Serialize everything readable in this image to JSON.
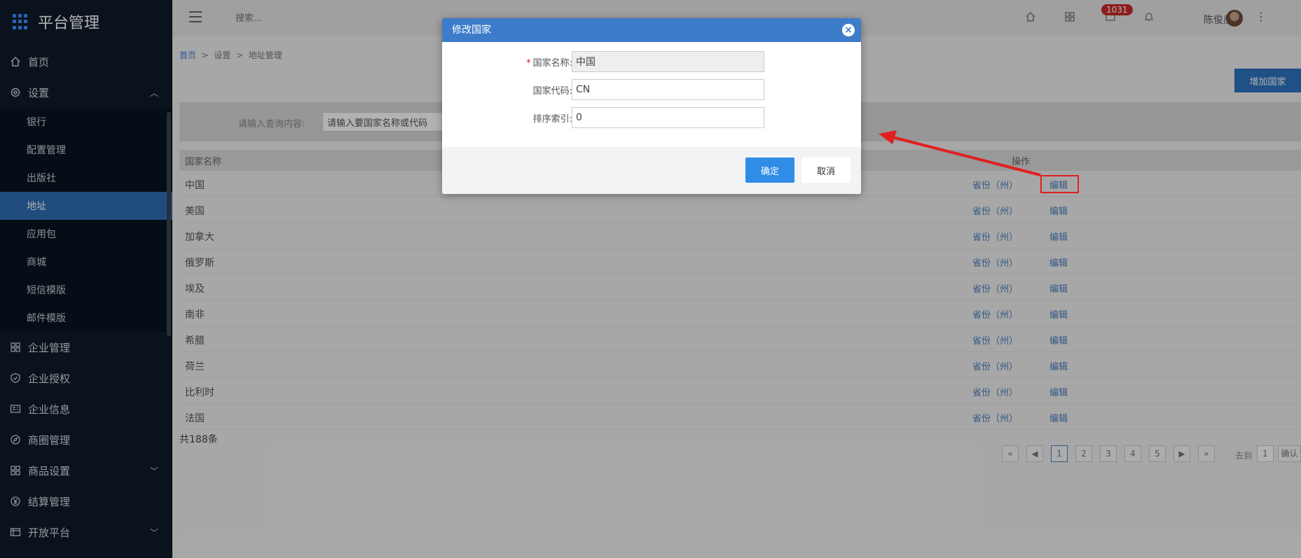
{
  "app": {
    "title": "平台管理"
  },
  "sidebar": {
    "items": [
      {
        "label": "首页"
      },
      {
        "label": "设置"
      },
      {
        "label": "企业管理"
      },
      {
        "label": "企业授权"
      },
      {
        "label": "企业信息"
      },
      {
        "label": "商圈管理"
      },
      {
        "label": "商品设置"
      },
      {
        "label": "结算管理"
      },
      {
        "label": "开放平台"
      }
    ],
    "settings_sub": [
      {
        "label": "银行"
      },
      {
        "label": "配置管理"
      },
      {
        "label": "出版社"
      },
      {
        "label": "地址"
      },
      {
        "label": "应用包"
      },
      {
        "label": "商城"
      },
      {
        "label": "短信模版"
      },
      {
        "label": "邮件模版"
      }
    ]
  },
  "topbar": {
    "search_placeholder": "搜索...",
    "badge_count": "1031",
    "user_name": "陈俊彦 ⌄"
  },
  "breadcrumb": {
    "home": "首页",
    "sep": ">",
    "level1": "设置",
    "level2": "地址管理"
  },
  "main": {
    "add_button": "增加国家",
    "filter_label": "请输入查询内容:",
    "filter_value": "请输入要国家名称或代码",
    "table": {
      "col_name": "国家名称",
      "col_ops": "操作",
      "rows": [
        {
          "name": "中国",
          "op1": "省份（州）",
          "op2": "编辑"
        },
        {
          "name": "美国",
          "op1": "省份（州）",
          "op2": "编辑"
        },
        {
          "name": "加拿大",
          "op1": "省份（州）",
          "op2": "编辑"
        },
        {
          "name": "俄罗斯",
          "op1": "省份（州）",
          "op2": "编辑"
        },
        {
          "name": "埃及",
          "op1": "省份（州）",
          "op2": "编辑"
        },
        {
          "name": "南非",
          "op1": "省份（州）",
          "op2": "编辑"
        },
        {
          "name": "希腊",
          "op1": "省份（州）",
          "op2": "编辑"
        },
        {
          "name": "荷兰",
          "op1": "省份（州）",
          "op2": "编辑"
        },
        {
          "name": "比利时",
          "op1": "省份（州）",
          "op2": "编辑"
        },
        {
          "name": "法国",
          "op1": "省份（州）",
          "op2": "编辑"
        }
      ]
    },
    "total": "共188条",
    "pager": {
      "first": "«",
      "prev": "◀",
      "pages": [
        "1",
        "2",
        "3",
        "4",
        "5"
      ],
      "next": "▶",
      "last": "»",
      "current": "1"
    },
    "goto_label": "去到",
    "goto_value": "1",
    "goto_btn": "确认"
  },
  "modal": {
    "title": "修改国家",
    "fields": [
      {
        "label": "国家名称:",
        "value": "中国",
        "required": true
      },
      {
        "label": "国家代码:",
        "value": "CN",
        "required": false
      },
      {
        "label": "排序索引:",
        "value": "0",
        "required": false
      }
    ],
    "ok": "确定",
    "cancel": "取消"
  },
  "colors": {
    "accent": "#3d7cc9",
    "sidebar_bg": "#0f1c2a",
    "active_item": "#2f6db5",
    "annotation": "#e02020"
  }
}
